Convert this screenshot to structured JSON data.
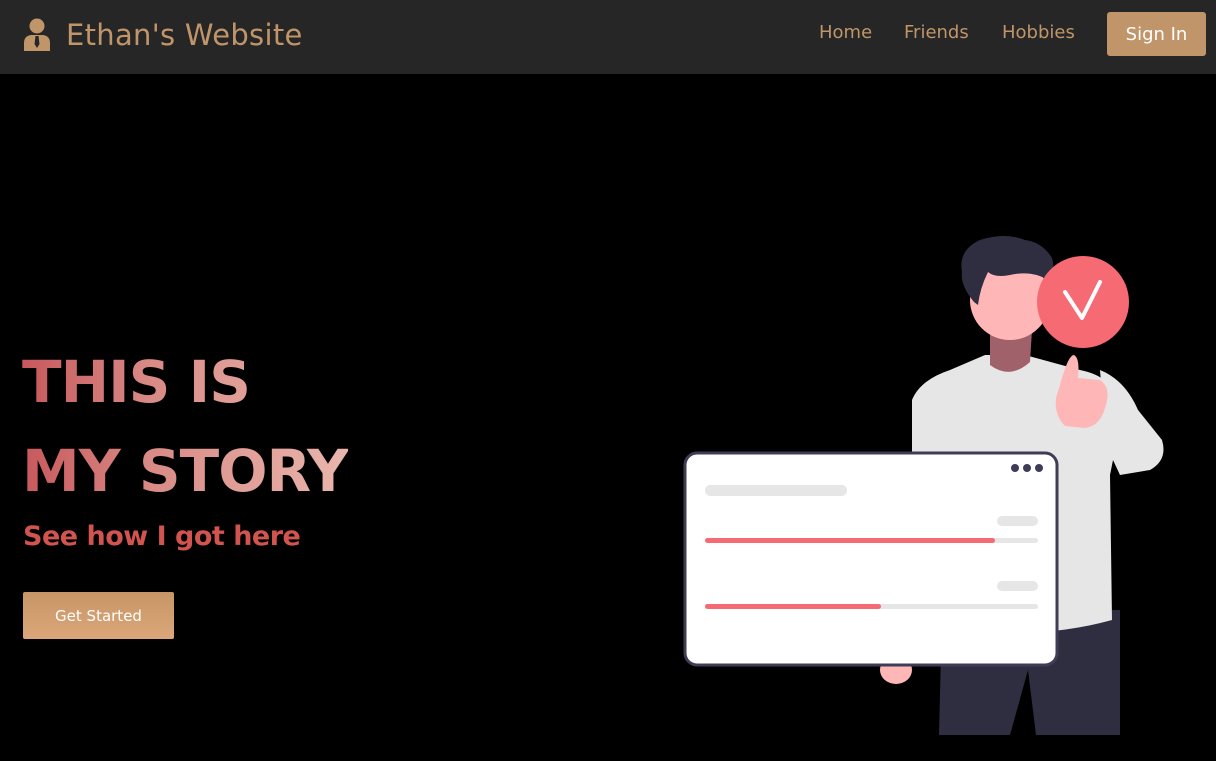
{
  "header": {
    "brand_icon": "user-tie-icon",
    "brand_text": "Ethan's Website",
    "nav": {
      "home": "Home",
      "friends": "Friends",
      "hobbies": "Hobbies"
    },
    "sign_in_label": "Sign In"
  },
  "hero": {
    "title_line1": "THIS IS",
    "title_line2": "MY STORY",
    "subtitle": "See how I got here",
    "cta_label": "Get Started"
  },
  "illustration": {
    "name": "person-holding-checklist",
    "badge_icon": "checkmark-icon",
    "menu_icon": "more-dots-icon",
    "progress": [
      0.87,
      0.53
    ]
  },
  "colors": {
    "brand": "#c0956a",
    "nav_background": "#262626",
    "page_background": "#000000",
    "accent_red": "#f66a73",
    "subtitle": "#d1544f"
  }
}
